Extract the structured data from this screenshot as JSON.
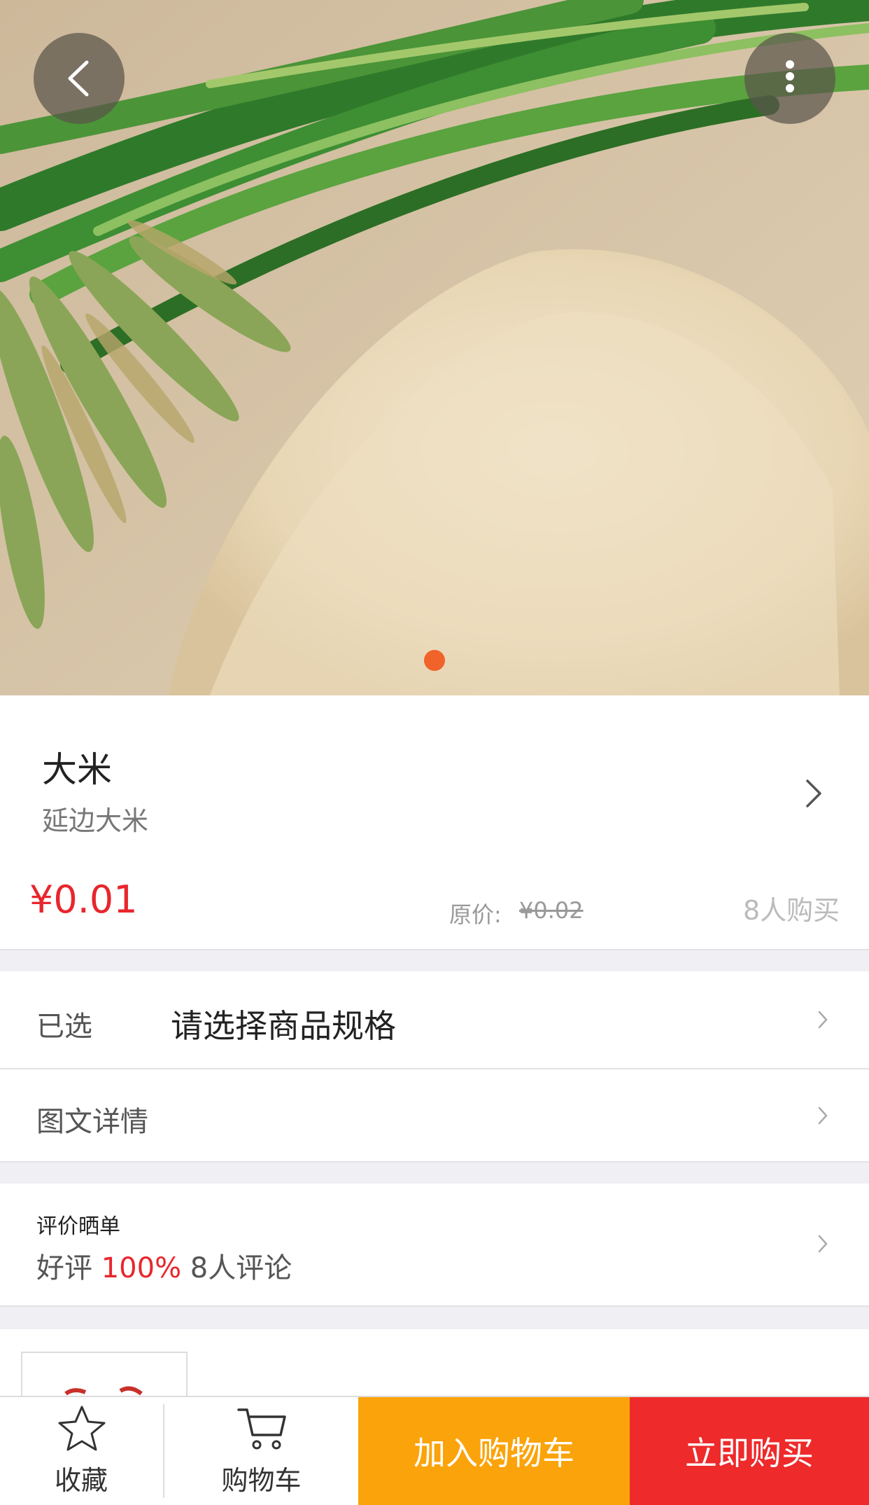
{
  "topbar": {
    "back_icon": "chevron-left-icon",
    "more_icon": "more-vertical-icon"
  },
  "gallery": {
    "image_subject": "rice-grains-photo",
    "pagination_active_color": "#f0632a"
  },
  "product": {
    "name": "大米",
    "subtitle": "延边大米",
    "price": "¥0.01",
    "original_price_label": "原价:",
    "original_price": "¥0.02",
    "buyers": "8人购买",
    "price_color": "#e8262d"
  },
  "spec": {
    "label": "已选",
    "value": "请选择商品规格"
  },
  "details": {
    "label": "图文详情"
  },
  "reviews": {
    "title": "评价晒单",
    "good_label": "好评",
    "good_rate": "100%",
    "count": "8人评论"
  },
  "bottom_bar": {
    "favorite_label": "收藏",
    "favorite_icon": "star-icon",
    "cart_label": "购物车",
    "cart_icon": "cart-icon",
    "add_to_cart": "加入购物车",
    "buy_now": "立即购买",
    "add_color": "#fba30a",
    "buy_color": "#ee2a2b"
  }
}
